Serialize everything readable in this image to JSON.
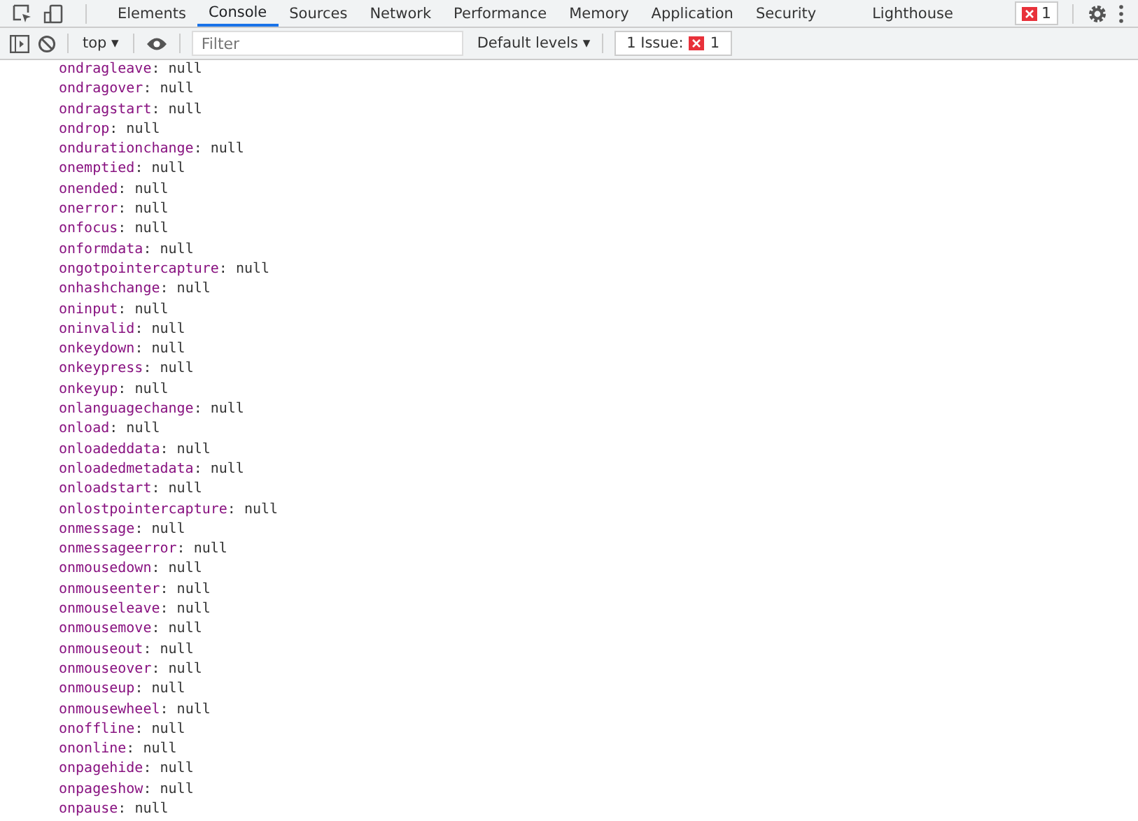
{
  "tabs": [
    {
      "label": "Elements",
      "selected": false
    },
    {
      "label": "Console",
      "selected": true
    },
    {
      "label": "Sources",
      "selected": false
    },
    {
      "label": "Network",
      "selected": false
    },
    {
      "label": "Performance",
      "selected": false
    },
    {
      "label": "Memory",
      "selected": false
    },
    {
      "label": "Application",
      "selected": false
    },
    {
      "label": "Security",
      "selected": false
    },
    {
      "label": "Lighthouse",
      "selected": false
    }
  ],
  "error_badge": "1",
  "toolbar": {
    "context": "top",
    "context_caret": "▾",
    "levels_caret": "▾",
    "filter": {
      "placeholder": "Filter"
    },
    "levels": "Default levels",
    "issues": {
      "label": "1 Issue:",
      "count": "1"
    }
  },
  "properties": [
    {
      "key": "ondragleave",
      "separator": ":",
      "value": "null"
    },
    {
      "key": "ondragover",
      "separator": ":",
      "value": "null"
    },
    {
      "key": "ondragstart",
      "separator": ":",
      "value": "null"
    },
    {
      "key": "ondrop",
      "separator": ":",
      "value": "null"
    },
    {
      "key": "ondurationchange",
      "separator": ":",
      "value": "null"
    },
    {
      "key": "onemptied",
      "separator": ":",
      "value": "null"
    },
    {
      "key": "onended",
      "separator": ":",
      "value": "null"
    },
    {
      "key": "onerror",
      "separator": ":",
      "value": "null"
    },
    {
      "key": "onfocus",
      "separator": ":",
      "value": "null"
    },
    {
      "key": "onformdata",
      "separator": ":",
      "value": "null"
    },
    {
      "key": "ongotpointercapture",
      "separator": ":",
      "value": "null"
    },
    {
      "key": "onhashchange",
      "separator": ":",
      "value": "null"
    },
    {
      "key": "oninput",
      "separator": ":",
      "value": "null"
    },
    {
      "key": "oninvalid",
      "separator": ":",
      "value": "null"
    },
    {
      "key": "onkeydown",
      "separator": ":",
      "value": "null"
    },
    {
      "key": "onkeypress",
      "separator": ":",
      "value": "null"
    },
    {
      "key": "onkeyup",
      "separator": ":",
      "value": "null"
    },
    {
      "key": "onlanguagechange",
      "separator": ":",
      "value": "null"
    },
    {
      "key": "onload",
      "separator": ":",
      "value": "null"
    },
    {
      "key": "onloadeddata",
      "separator": ":",
      "value": "null"
    },
    {
      "key": "onloadedmetadata",
      "separator": ":",
      "value": "null"
    },
    {
      "key": "onloadstart",
      "separator": ":",
      "value": "null"
    },
    {
      "key": "onlostpointercapture",
      "separator": ":",
      "value": "null"
    },
    {
      "key": "onmessage",
      "separator": ":",
      "value": "null"
    },
    {
      "key": "onmessageerror",
      "separator": ":",
      "value": "null"
    },
    {
      "key": "onmousedown",
      "separator": ":",
      "value": "null"
    },
    {
      "key": "onmouseenter",
      "separator": ":",
      "value": "null"
    },
    {
      "key": "onmouseleave",
      "separator": ":",
      "value": "null"
    },
    {
      "key": "onmousemove",
      "separator": ":",
      "value": "null"
    },
    {
      "key": "onmouseout",
      "separator": ":",
      "value": "null"
    },
    {
      "key": "onmouseover",
      "separator": ":",
      "value": "null"
    },
    {
      "key": "onmouseup",
      "separator": ":",
      "value": "null"
    },
    {
      "key": "onmousewheel",
      "separator": ":",
      "value": "null"
    },
    {
      "key": "onoffline",
      "separator": ":",
      "value": "null"
    },
    {
      "key": "ononline",
      "separator": ":",
      "value": "null"
    },
    {
      "key": "onpagehide",
      "separator": ":",
      "value": "null"
    },
    {
      "key": "onpageshow",
      "separator": ":",
      "value": "null"
    },
    {
      "key": "onpause",
      "separator": ":",
      "value": "null"
    }
  ]
}
